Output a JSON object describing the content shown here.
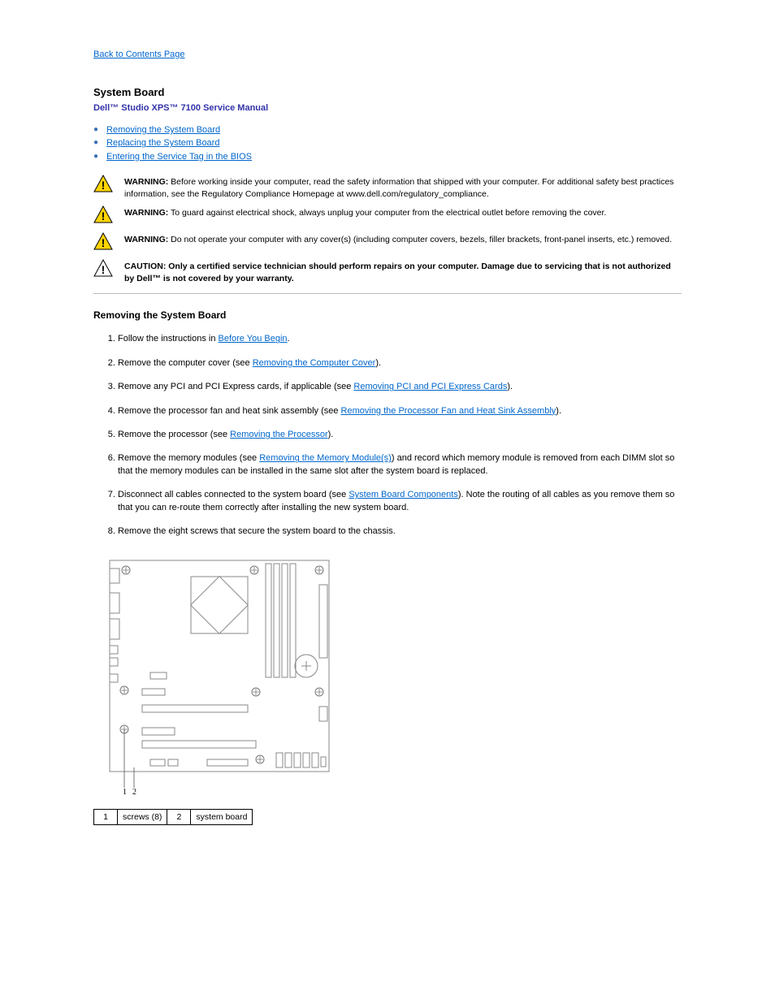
{
  "breadcrumb": "Back to Contents Page",
  "page_title": "System Board",
  "manual": "Dell™ Studio XPS™ 7100 Service Manual",
  "toc": [
    "Removing the System Board",
    "Replacing the System Board",
    "Entering the Service Tag in the BIOS"
  ],
  "alerts": [
    {
      "type": "warn",
      "lead": "WARNING:",
      "body": "Before working inside your computer, read the safety information that shipped with your computer. For additional safety best practices information, see the Regulatory Compliance Homepage at www.dell.com/regulatory_compliance."
    },
    {
      "type": "warn",
      "lead": "WARNING:",
      "body": "To guard against electrical shock, always unplug your computer from the electrical outlet before removing the cover."
    },
    {
      "type": "warn",
      "lead": "WARNING:",
      "body": "Do not operate your computer with any cover(s) (including computer covers, bezels, filler brackets, front-panel inserts, etc.) removed."
    },
    {
      "type": "caution",
      "lead": "CAUTION:",
      "body": "Only a certified service technician should perform repairs on your computer. Damage due to servicing that is not authorized by Dell™ is not covered by your warranty."
    }
  ],
  "section_remove": "Removing the System Board",
  "steps": [
    {
      "pre": "Follow the instructions in ",
      "link": "Before You Begin",
      "post": "."
    },
    {
      "pre": "Remove the computer cover (see ",
      "link": "Removing the Computer Cover",
      "post": ")."
    },
    {
      "pre": "Remove any PCI and PCI Express cards, if applicable (see ",
      "link": "Removing PCI and PCI Express Cards",
      "post": ")."
    },
    {
      "pre": "Remove the processor fan and heat sink assembly (see ",
      "link": "Removing the Processor Fan and Heat Sink Assembly",
      "post": ")."
    },
    {
      "pre": "Remove the processor (see ",
      "link": "Removing the Processor",
      "post": ")."
    },
    {
      "pre": "Remove the memory modules (see ",
      "link": "Removing the Memory Module(s)",
      "post": ") and record which memory module is removed from each DIMM slot so that the memory modules can be installed in the same slot after the system board is replaced."
    },
    {
      "pre": "Disconnect all cables connected to the system board (see ",
      "link": "System Board Components",
      "post": "). Note the routing of all cables as you remove them so that you can re-route them correctly after installing the new system board."
    },
    {
      "pre": "Remove the eight screws that secure the system board to the chassis.",
      "link": "",
      "post": ""
    }
  ],
  "parts": {
    "r1c1": "1",
    "r1c2": "screws (8)",
    "r2c1": "2",
    "r2c2": "system board"
  }
}
